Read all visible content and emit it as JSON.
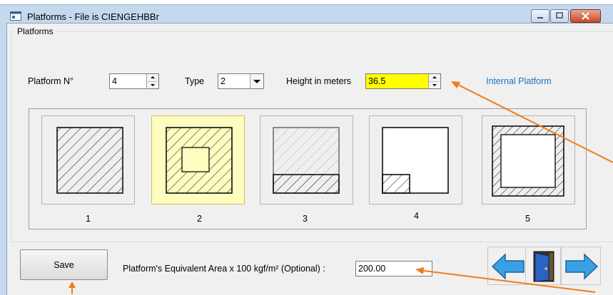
{
  "window": {
    "title": "Platforms - File is CIENGEHBBr",
    "icon": "app-window-icon",
    "controls": [
      "minimize-icon",
      "maximize-icon",
      "close-icon"
    ]
  },
  "group": {
    "legend": "Platforms"
  },
  "fields": {
    "platform_label": "Platform N°",
    "platform_value": "4",
    "type_label": "Type",
    "type_value": "2",
    "height_label": "Height in meters",
    "height_value": "36.5",
    "status_text": "Internal Platform"
  },
  "platforms": [
    {
      "label": "1",
      "pattern": "full-hatch"
    },
    {
      "label": "2",
      "pattern": "hatch-with-center-opening"
    },
    {
      "label": "3",
      "pattern": "light-hatch-bottom-strip"
    },
    {
      "label": "4",
      "pattern": "corner-hatch"
    },
    {
      "label": "5",
      "pattern": "border-hatch"
    }
  ],
  "bottom": {
    "save_label": "Save",
    "area_label": "Platform's Equivalent Area x 100 kgf/m² (Optional) :",
    "area_value": "200.00",
    "nav_icons": [
      "arrow-left-icon",
      "exit-door-icon",
      "arrow-right-icon"
    ]
  },
  "colors": {
    "highlight_field": "#ffff00",
    "selected_platform": "#fffcc0",
    "link_text": "#1a73c6",
    "annotation_arrow": "#f07c1a",
    "nav_arrow": "#3aa0e6"
  }
}
